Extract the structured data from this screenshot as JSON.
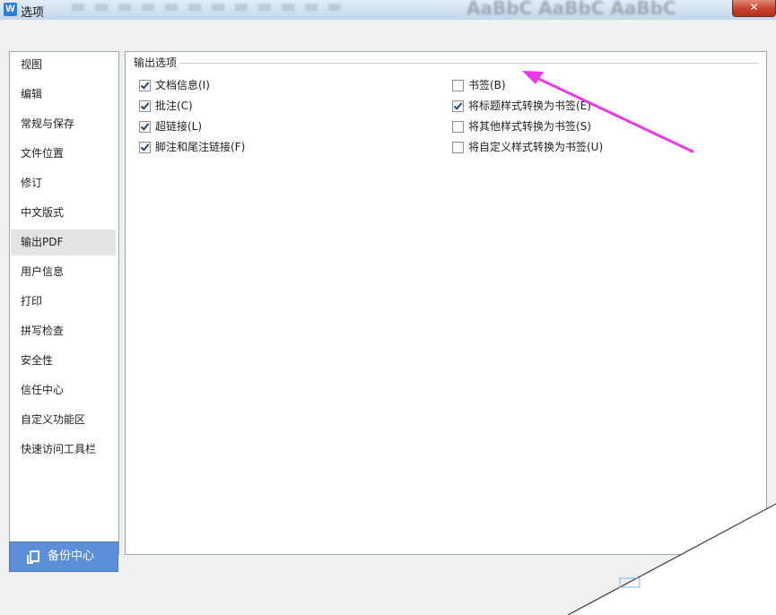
{
  "window": {
    "title": "选项",
    "app_icon_glyph": "W",
    "close_glyph": "✕",
    "background_ghost_text": "AaBbC AaBbC AaBbC"
  },
  "sidebar": {
    "items": [
      {
        "label": "视图"
      },
      {
        "label": "编辑"
      },
      {
        "label": "常规与保存"
      },
      {
        "label": "文件位置"
      },
      {
        "label": "修订"
      },
      {
        "label": "中文版式"
      },
      {
        "label": "输出PDF",
        "selected": true
      },
      {
        "label": "用户信息"
      },
      {
        "label": "打印"
      },
      {
        "label": "拼写检查"
      },
      {
        "label": "安全性"
      },
      {
        "label": "信任中心"
      },
      {
        "label": "自定义功能区"
      },
      {
        "label": "快速访问工具栏"
      }
    ],
    "backup_button": {
      "label": "备份中心",
      "icon": "backup-icon"
    }
  },
  "output_options": {
    "group_label": "输出选项",
    "left_column": [
      {
        "label": "文档信息(I)",
        "checked": true
      },
      {
        "label": "批注(C)",
        "checked": true
      },
      {
        "label": "超链接(L)",
        "checked": true
      },
      {
        "label": "脚注和尾注链接(F)",
        "checked": true
      }
    ],
    "right_column": [
      {
        "label": "书签(B)",
        "checked": false
      },
      {
        "label": "将标题样式转换为书签(E)",
        "checked": true
      },
      {
        "label": "将其他样式转换为书签(S)",
        "checked": false
      },
      {
        "label": "将自定义样式转换为书签(U)",
        "checked": false
      }
    ]
  },
  "annotation": {
    "arrow_color": "#e838e8"
  },
  "colors": {
    "selected_nav": "#e4e4e4",
    "backup_button": "#5b8fd8",
    "close_button": "#c7402c"
  }
}
